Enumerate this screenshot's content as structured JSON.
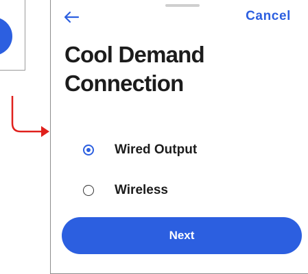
{
  "header": {
    "back_icon": "arrow-left-icon",
    "cancel_label": "Cancel"
  },
  "title": {
    "line1": "Cool Demand",
    "line2": "Connection"
  },
  "options": [
    {
      "label": "Wired Output",
      "selected": true
    },
    {
      "label": "Wireless",
      "selected": false
    }
  ],
  "footer": {
    "next_label": "Next"
  },
  "colors": {
    "accent": "#2c5fe0",
    "flow_arrow": "#e0201c",
    "text": "#1c1c1c"
  }
}
